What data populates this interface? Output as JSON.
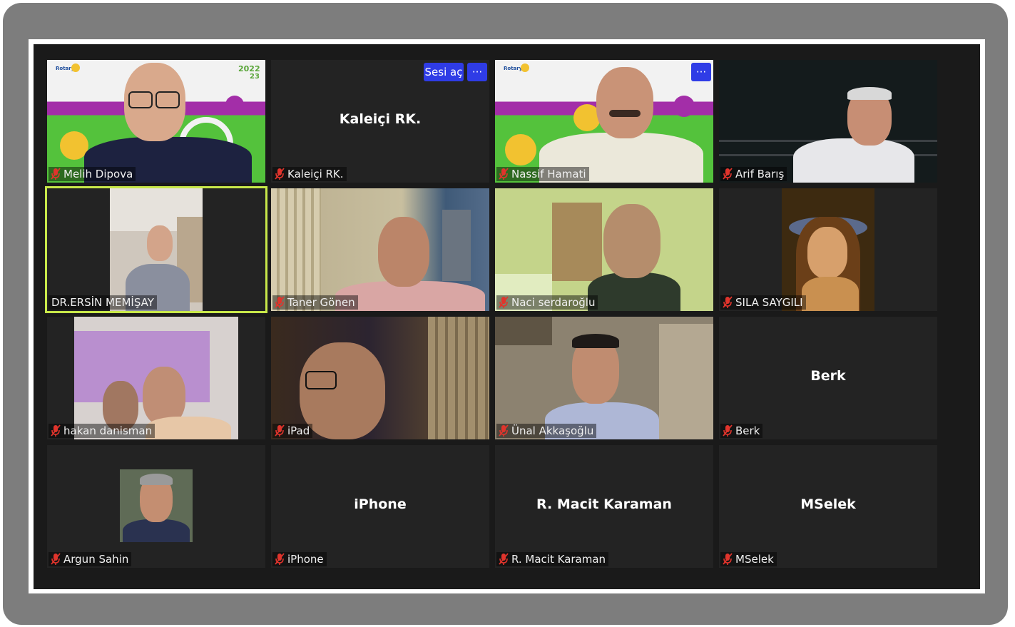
{
  "tiles": [
    {
      "id": "melih",
      "name": "Melih Dipova"
    },
    {
      "id": "kaleici",
      "name": "Kaleiçi RK.",
      "center": "Kaleiçi RK.",
      "unmute_label": "Sesi aç",
      "more_label": "···"
    },
    {
      "id": "nassif",
      "name": "Nassif Hamati",
      "more_label": "···"
    },
    {
      "id": "arif",
      "name": "Arif Barış"
    },
    {
      "id": "ersin",
      "name": "DR.ERSİN MEMİŞAY"
    },
    {
      "id": "taner",
      "name": "Taner Gönen"
    },
    {
      "id": "naci",
      "name": "Naci serdaroğlu"
    },
    {
      "id": "sila",
      "name": "SILA SAYGILI"
    },
    {
      "id": "hakan",
      "name": "hakan danisman"
    },
    {
      "id": "ipad",
      "name": "iPad"
    },
    {
      "id": "unal",
      "name": "Ünal Akkaşoğlu"
    },
    {
      "id": "berk",
      "name": "Berk",
      "center": "Berk"
    },
    {
      "id": "argun",
      "name": "Argun Sahin"
    },
    {
      "id": "iphone",
      "name": "iPhone",
      "center": "iPhone"
    },
    {
      "id": "macit",
      "name": "R. Macit Karaman",
      "center": "R. Macit Karaman"
    },
    {
      "id": "mselek",
      "name": "MSelek",
      "center": "MSelek"
    }
  ],
  "rotary_logo": {
    "brand": "Rotary",
    "year_top": "2022",
    "year_bottom": "23"
  },
  "colors": {
    "active_speaker": "#c8e84a",
    "button_blue": "#2f3ce6",
    "muted_red": "#e0342c",
    "tile_bg": "#232323"
  },
  "icons": {
    "muted": "mic-muted-icon",
    "more": "ellipsis-icon"
  }
}
